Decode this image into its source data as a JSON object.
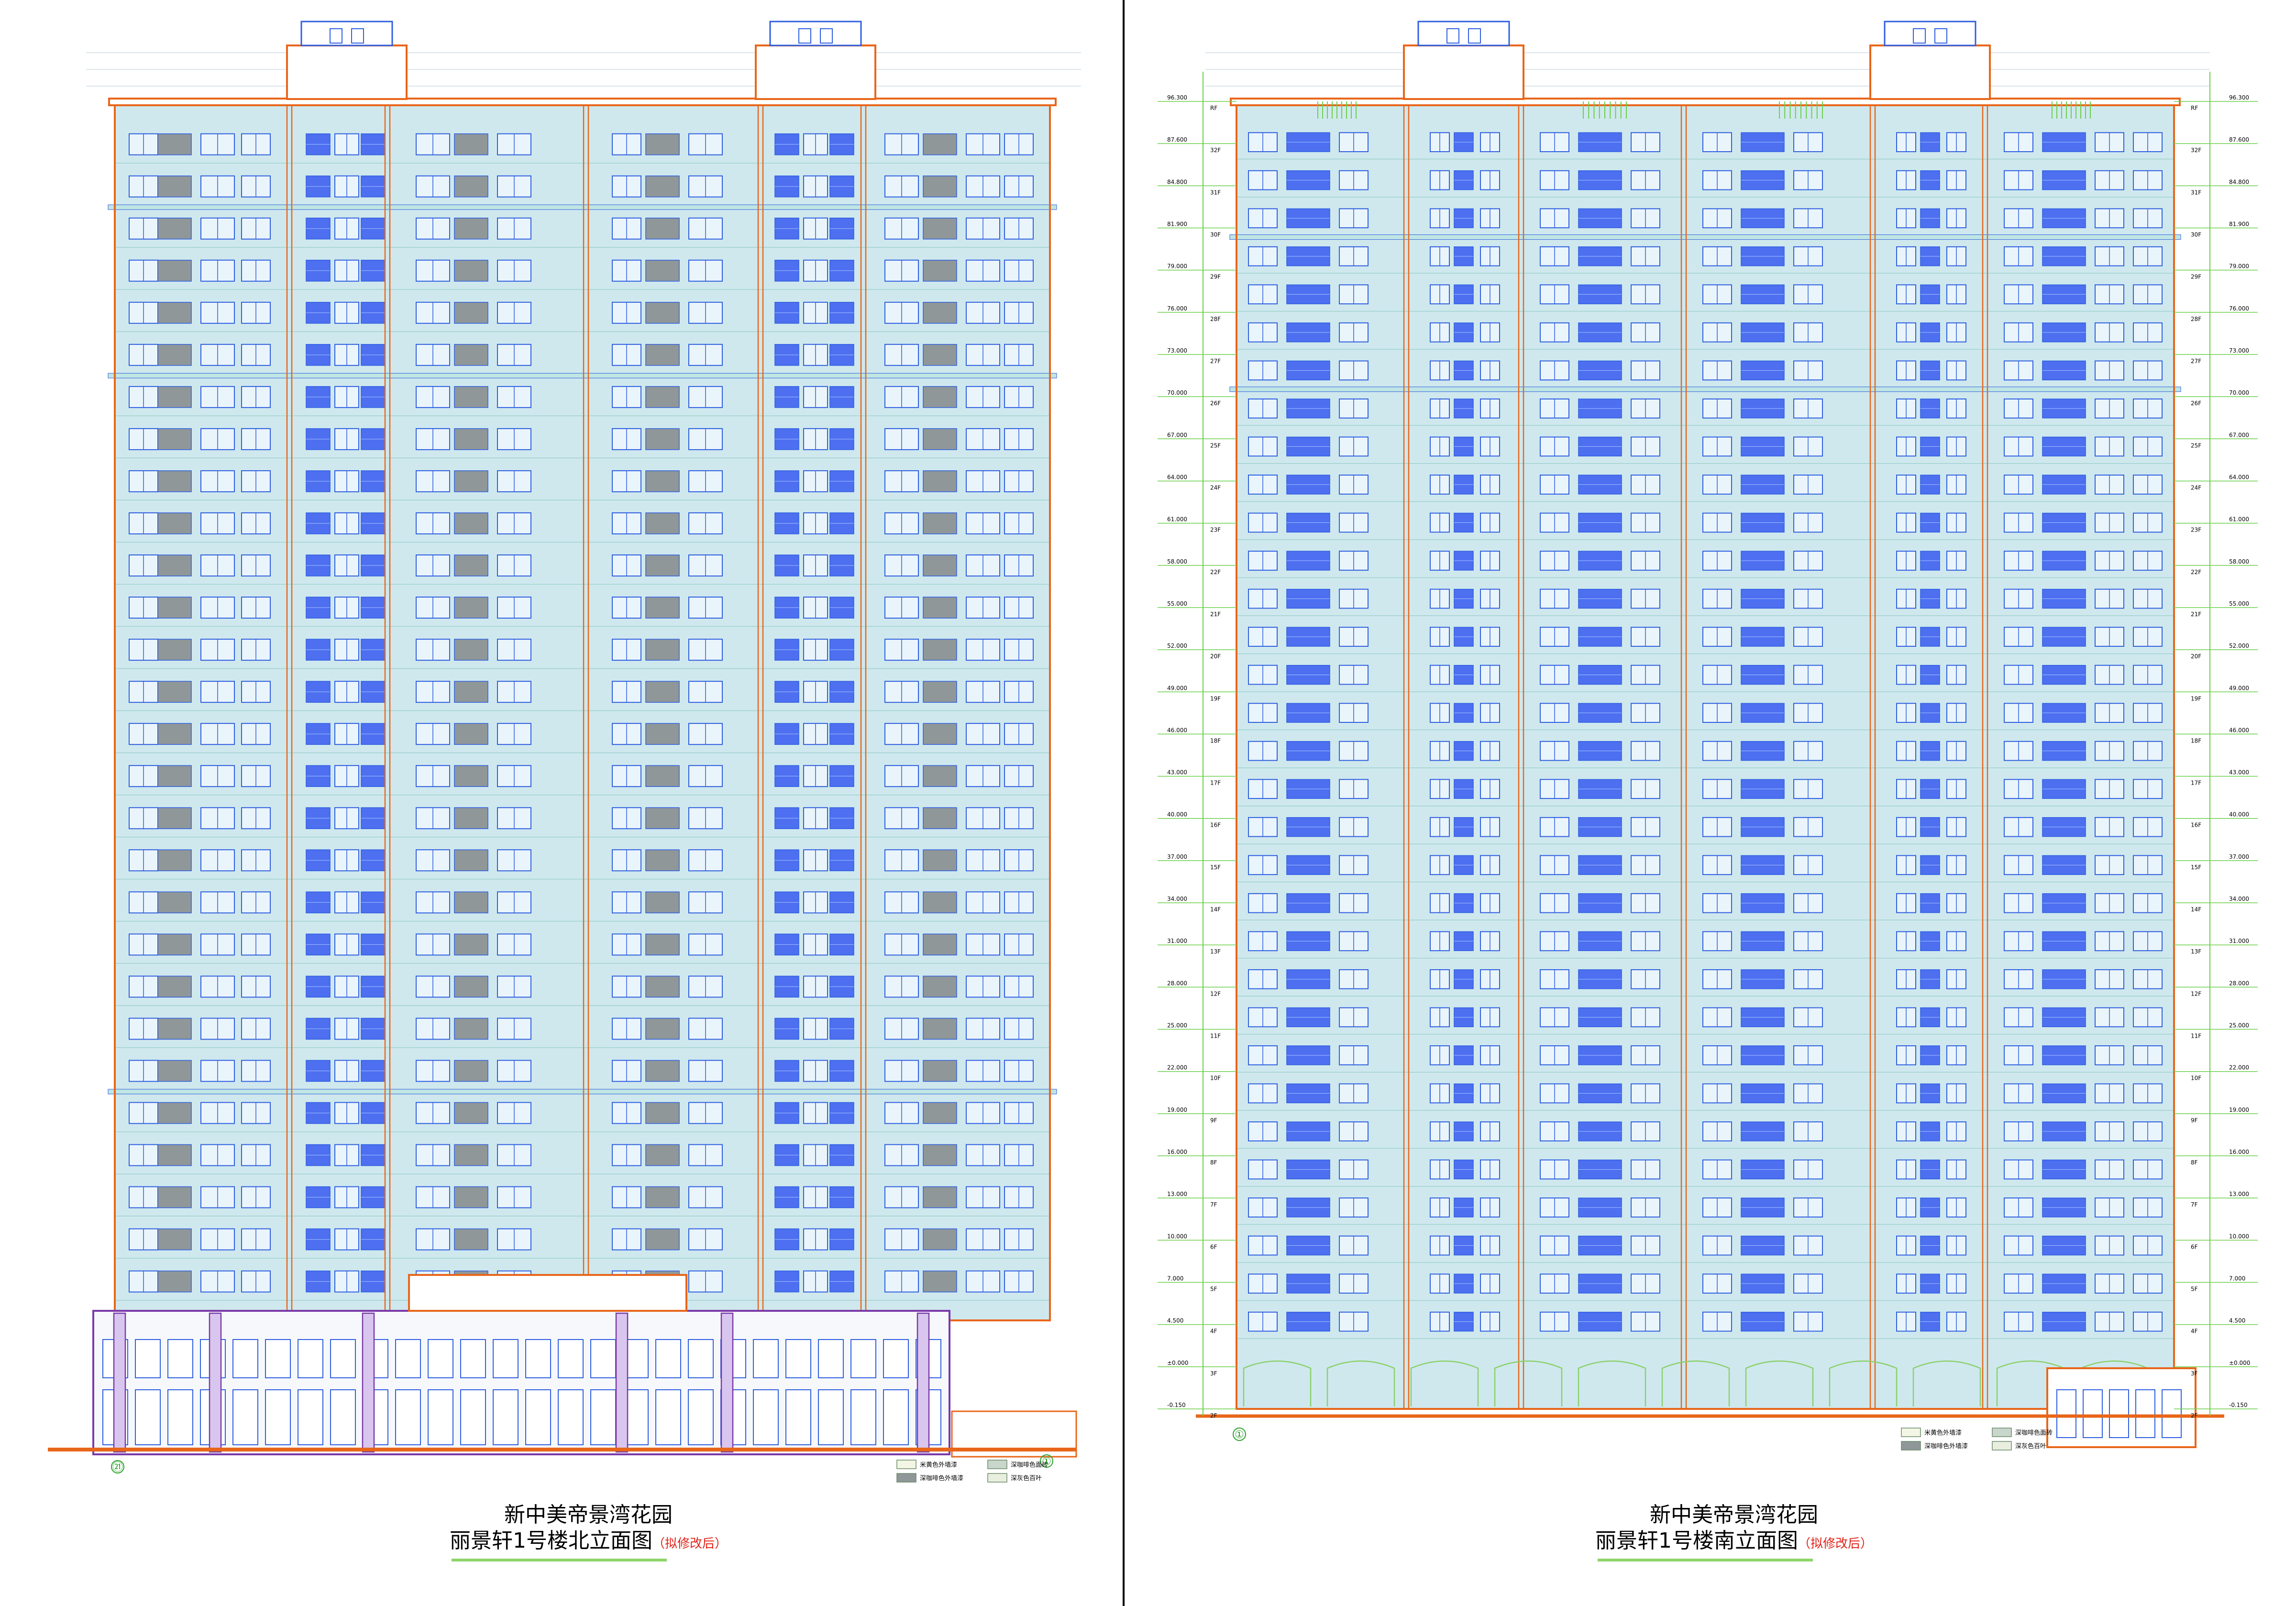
{
  "sheets": [
    {
      "id": "north",
      "project": "新中美帝景湾花园",
      "drawing": "丽景轩1号楼北立面图",
      "note": "（拟修改后）",
      "legend": [
        "米黄色外墙漆",
        "深咖啡色面砖",
        "深咖啡色外墙漆",
        "深灰色百叶"
      ]
    },
    {
      "id": "south",
      "project": "新中美帝景湾花园",
      "drawing": "丽景轩1号楼南立面图",
      "note": "（拟修改后）",
      "legend": [
        "米黄色外墙漆",
        "深咖啡色面砖",
        "深咖啡色外墙漆",
        "深灰色百叶"
      ]
    }
  ],
  "grid_labels": {
    "north_left": "㉑",
    "north_right": "①",
    "south_left": "①"
  },
  "levels": [
    "96.300",
    "87.600",
    "84.800",
    "81.900",
    "79.000",
    "76.000",
    "73.000",
    "70.000",
    "67.000",
    "64.000",
    "61.000",
    "58.000",
    "55.000",
    "52.000",
    "49.000",
    "46.000",
    "43.000",
    "40.000",
    "37.000",
    "34.000",
    "31.000",
    "28.000",
    "25.000",
    "22.000",
    "19.000",
    "16.000",
    "13.000",
    "10.000",
    "7.000",
    "4.500",
    "±0.000",
    "-0.150"
  ],
  "floors": [
    "RF",
    "32F",
    "31F",
    "30F",
    "29F",
    "28F",
    "27F",
    "26F",
    "25F",
    "24F",
    "23F",
    "22F",
    "21F",
    "20F",
    "19F",
    "18F",
    "17F",
    "16F",
    "15F",
    "14F",
    "13F",
    "12F",
    "11F",
    "10F",
    "9F",
    "8F",
    "7F",
    "6F",
    "5F",
    "4F",
    "3F",
    "2F",
    "1F"
  ],
  "colors": {
    "frame": "#e8661a",
    "window": "#2f5fe0",
    "glass": "#4d6ff0",
    "wall": "#cfe8ee",
    "panel": "#8f9799",
    "green": "#6ccf4a",
    "podium": "#7a3aa8"
  }
}
